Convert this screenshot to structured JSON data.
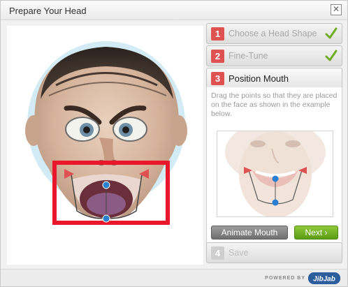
{
  "window": {
    "title": "Prepare Your Head",
    "close_label": "✕"
  },
  "steps": [
    {
      "num": "1",
      "label": "Choose a Head Shape",
      "state": "done",
      "check_icon": "check-icon"
    },
    {
      "num": "2",
      "label": "Fine-Tune",
      "state": "done",
      "check_icon": "check-icon"
    },
    {
      "num": "3",
      "label": "Position Mouth",
      "state": "active"
    },
    {
      "num": "4",
      "label": "Save",
      "state": "disabled"
    }
  ],
  "instructions": "Drag the points so that they are placed on the face as shown in the example below.",
  "buttons": {
    "animate": "Animate Mouth",
    "next": "Next ›"
  },
  "footer": {
    "powered_by": "POWERED BY",
    "brand": "JibJab"
  },
  "colors": {
    "accent_red": "#e05252",
    "next_green": "#6fae22",
    "mouth_box": "#e8172b",
    "handle_blue": "#2a7fd0"
  }
}
